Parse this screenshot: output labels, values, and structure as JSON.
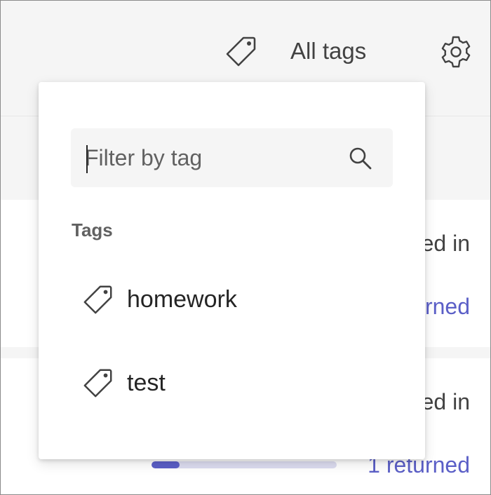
{
  "header": {
    "tag_filter_label": "All tags",
    "tag_icon": "tag-icon",
    "settings_icon": "gear-icon"
  },
  "dropdown": {
    "filter": {
      "placeholder": "Filter by tag",
      "value": "",
      "icon": "search-icon"
    },
    "section_heading": "Tags",
    "tags": [
      {
        "label": "homework",
        "icon": "tag-icon"
      },
      {
        "label": "test",
        "icon": "tag-icon"
      }
    ]
  },
  "background": {
    "row1": {
      "status_fragment": "ed in",
      "link_fragment": "rned"
    },
    "row2": {
      "status_fragment": "ed in",
      "link_fragment": "1 returned",
      "progress": 0.15
    }
  },
  "colors": {
    "accent": "#5b5fc7",
    "progress_track": "#dcdcf0",
    "surface": "#ffffff",
    "background": "#f5f5f5",
    "text_primary": "#242424",
    "text_secondary": "#616161"
  }
}
